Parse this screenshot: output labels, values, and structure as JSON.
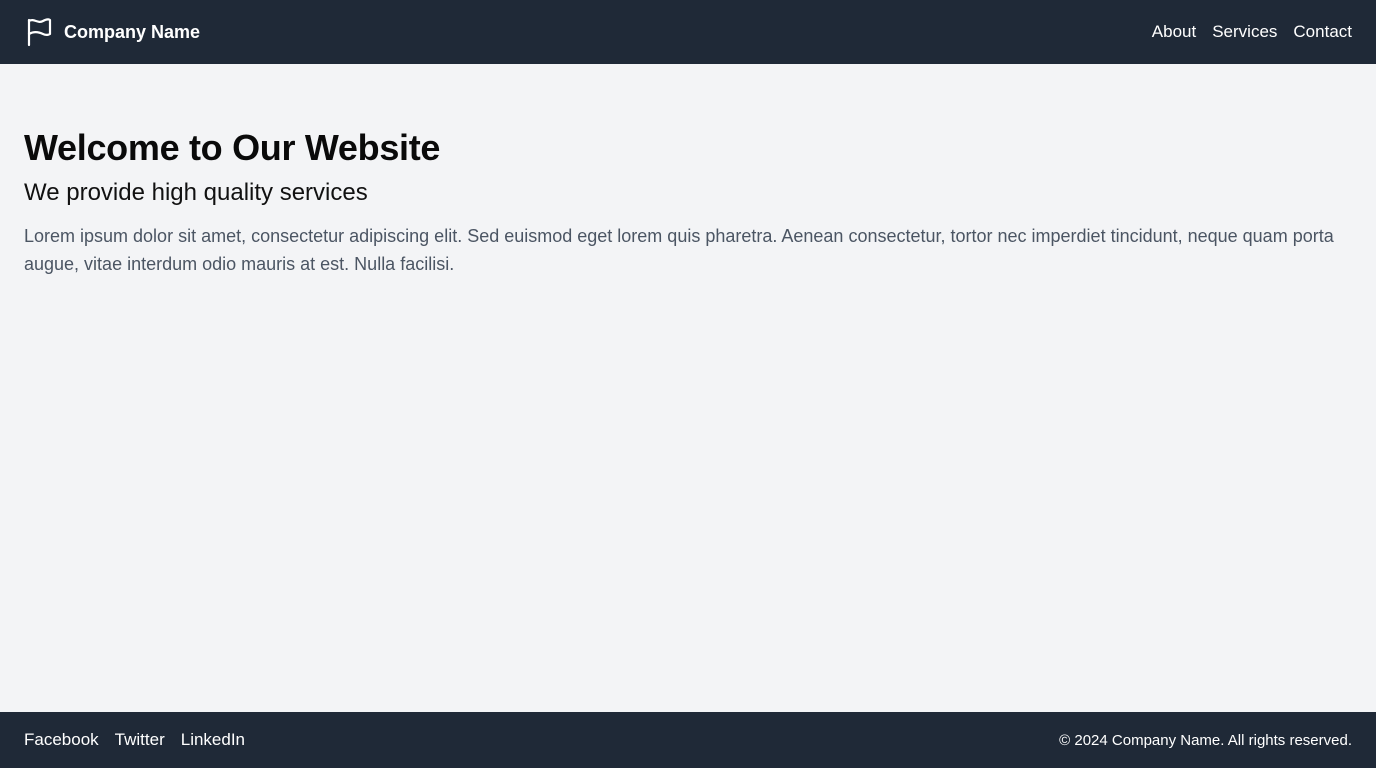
{
  "header": {
    "brand": {
      "icon": "flag-icon",
      "name": "Company Name"
    },
    "nav": [
      {
        "label": "About"
      },
      {
        "label": "Services"
      },
      {
        "label": "Contact"
      }
    ]
  },
  "main": {
    "title": "Welcome to Our Website",
    "subtitle": "We provide high quality services",
    "body": "Lorem ipsum dolor sit amet, consectetur adipiscing elit. Sed euismod eget lorem quis pharetra. Aenean consectetur, tortor nec imperdiet tincidunt, neque quam porta augue, vitae interdum odio mauris at est. Nulla facilisi."
  },
  "footer": {
    "social": [
      {
        "label": "Facebook"
      },
      {
        "label": "Twitter"
      },
      {
        "label": "LinkedIn"
      }
    ],
    "copyright": "© 2024 Company Name. All rights reserved."
  },
  "colors": {
    "header_bg": "#1f2937",
    "page_bg": "#f3f4f6",
    "body_text": "#4b5563"
  }
}
